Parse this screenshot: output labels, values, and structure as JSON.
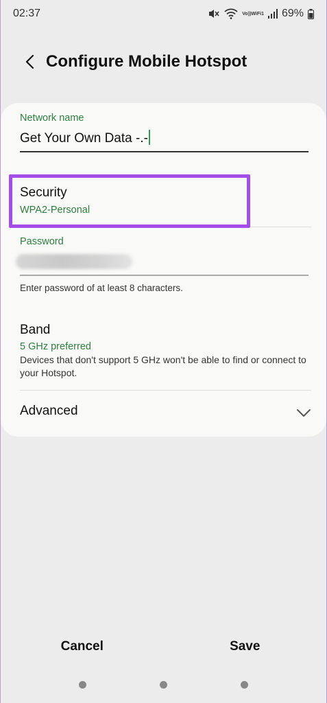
{
  "status_bar": {
    "time": "02:37",
    "battery_percent": "69%",
    "volte_top": "Vo))",
    "volte_bottom": "WiFi1",
    "icons": [
      "mute-icon",
      "wifi-icon",
      "volte-wifi-icon",
      "signal-icon",
      "battery-icon"
    ]
  },
  "header": {
    "title": "Configure Mobile Hotspot"
  },
  "form": {
    "network_name_label": "Network name",
    "network_name_value": "Get Your Own Data -.-",
    "security_title": "Security",
    "security_value": "WPA2-Personal",
    "password_label": "Password",
    "password_hint": "Enter password of at least 8 characters.",
    "band_title": "Band",
    "band_value": "5 GHz preferred",
    "band_description": "Devices that don't support 5 GHz won't be able to find or connect to your Hotspot.",
    "advanced_title": "Advanced"
  },
  "actions": {
    "cancel_label": "Cancel",
    "save_label": "Save"
  },
  "colors": {
    "accent_green": "#2d7d3f",
    "highlight_purple": "#a34ee8",
    "background": "#ececec",
    "card": "#f9f9f7"
  }
}
